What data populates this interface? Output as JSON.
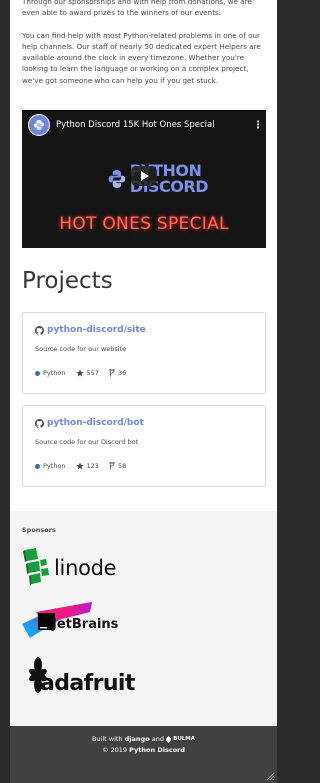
{
  "intro": {
    "para1": "Through our sponsorships and with help from donations, we are even able to award prizes to the winners of our events.",
    "para2": "You can find help with most Python-related problems in one of our help channels. Our staff of nearly 50 dedicated expert Helpers are available around the clock in every timezone. Whether you're looking to learn the language or working on a complex project, we've got someone who can help you if you get stuck."
  },
  "video": {
    "title": "Python Discord 15K Hot Ones Special",
    "logo_line1": "PYTHON",
    "logo_line2": "DISCORD",
    "subtitle": "HOT ONES SPECIAL",
    "menu_icon": "kebab-menu-icon"
  },
  "projects": {
    "heading": "Projects",
    "items": [
      {
        "name": "python-discord/site",
        "description": "Source code for our website",
        "language": "Python",
        "stars": "557",
        "forks": "36",
        "language_color": "#3572a5"
      },
      {
        "name": "python-discord/bot",
        "description": "Source code for our Discord bot",
        "language": "Python",
        "stars": "123",
        "forks": "58",
        "language_color": "#3572a5"
      }
    ]
  },
  "sponsors": {
    "title": "Sponsors",
    "items": [
      {
        "name": "linode"
      },
      {
        "name": "JetBrains"
      },
      {
        "name": "adafruit"
      }
    ]
  },
  "footer": {
    "built_with": "Built with",
    "django": "django",
    "and": "and",
    "bulma": "BULMA",
    "copyright": "© 2019",
    "org": "Python Discord"
  },
  "colors": {
    "accent": "#7289da",
    "background": "#2b2b2b",
    "footer": "#414141",
    "sponsor_bg": "#f5f5f5"
  }
}
